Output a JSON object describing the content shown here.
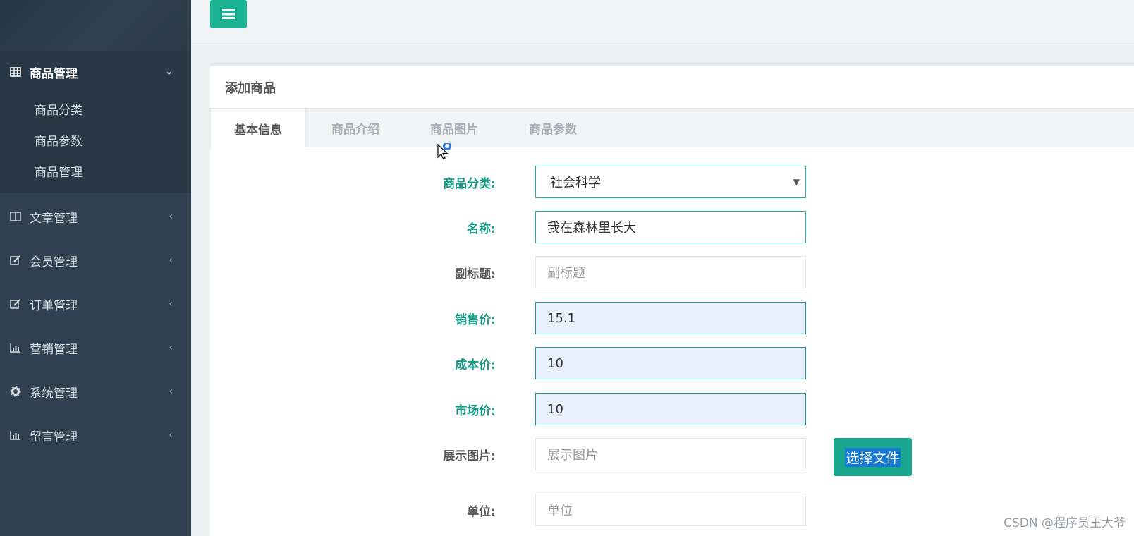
{
  "sidebar": {
    "active_group": {
      "label": "商品管理",
      "icon": "table-icon",
      "children": [
        {
          "label": "商品分类"
        },
        {
          "label": "商品参数"
        },
        {
          "label": "商品管理"
        }
      ]
    },
    "items": [
      {
        "label": "文章管理",
        "icon": "columns-icon"
      },
      {
        "label": "会员管理",
        "icon": "edit-icon"
      },
      {
        "label": "订单管理",
        "icon": "edit-icon"
      },
      {
        "label": "营销管理",
        "icon": "bar-chart-icon"
      },
      {
        "label": "系统管理",
        "icon": "gear-icon"
      },
      {
        "label": "留言管理",
        "icon": "bar-chart-icon"
      }
    ]
  },
  "topbar": {
    "menu_icon": "bars-icon"
  },
  "panel": {
    "title": "添加商品",
    "tabs": [
      {
        "label": "基本信息"
      },
      {
        "label": "商品介绍"
      },
      {
        "label": "商品图片"
      },
      {
        "label": "商品参数"
      }
    ]
  },
  "form": {
    "category": {
      "label": "商品分类:",
      "value": "社会科学"
    },
    "name": {
      "label": "名称:",
      "value": "我在森林里长大"
    },
    "subtitle": {
      "label": "副标题:",
      "placeholder": "副标题"
    },
    "sale_price": {
      "label": "销售价:",
      "value": "15.1"
    },
    "cost_price": {
      "label": "成本价:",
      "value": "10"
    },
    "market_price": {
      "label": "市场价:",
      "value": "10"
    },
    "display_image": {
      "label": "展示图片:",
      "placeholder": "展示图片",
      "button": "选择文件"
    },
    "unit": {
      "label": "单位:",
      "placeholder": "单位"
    }
  },
  "colors": {
    "sidebar": "#2f4050",
    "accent": "#1ab394",
    "label_teal": "#159a86"
  },
  "watermark": "CSDN @程序员王大爷"
}
